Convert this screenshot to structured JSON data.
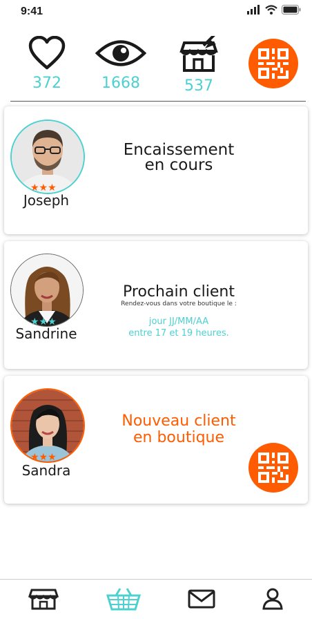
{
  "status": {
    "time": "9:41"
  },
  "stats": {
    "likes": "372",
    "views": "1668",
    "shop_visits": "537"
  },
  "cards": [
    {
      "name": "Joseph",
      "title_line1": "Encaissement",
      "title_line2": "en cours",
      "stars": "★★★",
      "rating": 3,
      "star_color": "#ff5b00",
      "ring_color": "#4dd0d0"
    },
    {
      "name": "Sandrine",
      "title": "Prochain client",
      "subtitle": "Rendez-vous dans votre boutique le :",
      "date_line": "jour JJ/MM/AA",
      "time_line": "entre 17 et 19 heures.",
      "stars": "★★★",
      "rating": 3,
      "star_color": "#4dd0d0",
      "ring_color": "#666666"
    },
    {
      "name": "Sandra",
      "title_line1": "Nouveau client",
      "title_line2": "en boutique",
      "stars": "★★★",
      "rating": 3,
      "star_color": "#ff5b00",
      "ring_color": "#ff5b00"
    }
  ],
  "colors": {
    "accent": "#ff5b00",
    "teal": "#4dd0d0"
  },
  "nav": {
    "items": [
      "shop-icon",
      "basket-icon",
      "mail-icon",
      "user-icon"
    ],
    "active": "basket-icon"
  }
}
